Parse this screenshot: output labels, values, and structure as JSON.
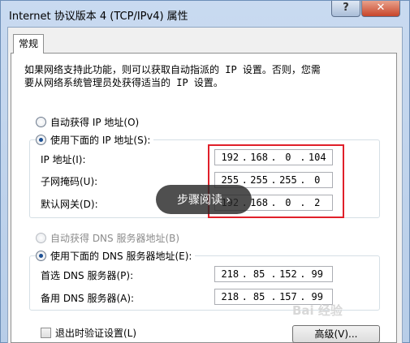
{
  "window": {
    "title": "Internet 协议版本 4 (TCP/IPv4) 属性"
  },
  "titlebar_buttons": {
    "help": "?",
    "close": "✕"
  },
  "tabs": [
    {
      "label": "常规"
    }
  ],
  "description": "如果网络支持此功能，则可以获取自动指派的 IP 设置。否则，您需\n要从网络系统管理员处获得适当的 IP 设置。",
  "ip_section": {
    "auto_label": "自动获得 IP 地址(O)",
    "manual_label": "使用下面的 IP 地址(S):",
    "fields": [
      {
        "label": "IP 地址(I):",
        "octets": [
          "192",
          "168",
          "0",
          "104"
        ]
      },
      {
        "label": "子网掩码(U):",
        "octets": [
          "255",
          "255",
          "255",
          "0"
        ]
      },
      {
        "label": "默认网关(D):",
        "octets": [
          "192",
          "168",
          "0",
          "2"
        ]
      }
    ]
  },
  "dns_section": {
    "auto_label": "自动获得 DNS 服务器地址(B)",
    "manual_label": "使用下面的 DNS 服务器地址(E):",
    "fields": [
      {
        "label": "首选 DNS 服务器(P):",
        "octets": [
          "218",
          "85",
          "152",
          "99"
        ]
      },
      {
        "label": "备用 DNS 服务器(A):",
        "octets": [
          "218",
          "85",
          "157",
          "99"
        ]
      }
    ]
  },
  "validate_on_exit": {
    "label": "退出时验证设置(L)"
  },
  "advanced_button": {
    "label": "高级(V)..."
  },
  "overlay": {
    "label": "步骤阅读 ›"
  },
  "watermark": {
    "text": "Bai 经验"
  }
}
